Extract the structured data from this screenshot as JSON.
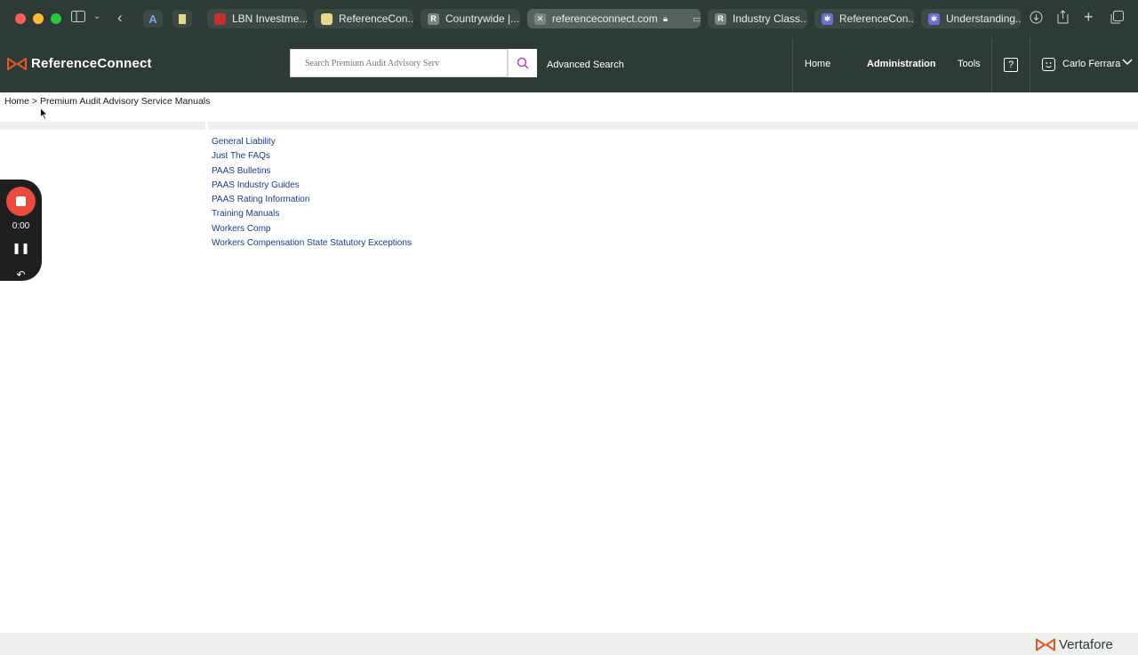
{
  "browser": {
    "tabs": [
      {
        "label": "LBN Investme...",
        "fav_color": "#c4302b",
        "fav_text": ""
      },
      {
        "label": "ReferenceCon...",
        "fav_color": "#e8d88a",
        "fav_text": ""
      },
      {
        "label": "Countrywide |...",
        "fav_color": "#7a8580",
        "fav_text": "R"
      },
      {
        "label": "referenceconnect.com",
        "fav_color": "#7a8580",
        "fav_text": "✕",
        "active": true
      },
      {
        "label": "Industry Class...",
        "fav_color": "#7a8580",
        "fav_text": "R"
      },
      {
        "label": "ReferenceCon...",
        "fav_color": "#6c6fd6",
        "fav_text": "✱"
      },
      {
        "label": "Understanding...",
        "fav_color": "#6c6fd6",
        "fav_text": "✱"
      }
    ],
    "profile_letter": "A"
  },
  "header": {
    "brand": "ReferenceConnect",
    "search_placeholder": "Search Premium Audit Advisory Serv",
    "advanced_search": "Advanced Search",
    "nav": {
      "home": "Home",
      "administration": "Administration",
      "tools": "Tools"
    },
    "help": "?",
    "user_name": "Carlo Ferrara"
  },
  "breadcrumb": "Home > Premium Audit Advisory Service Manuals",
  "links": [
    "General Liability",
    "Just The FAQs",
    "PAAS Bulletins",
    "PAAS Industry Guides",
    "PAAS Rating Information",
    "Training Manuals",
    "Workers Comp",
    "Workers Compensation State Statutory Exceptions"
  ],
  "recorder": {
    "time": "0:00"
  },
  "footer": {
    "brand": "Vertafore"
  },
  "colors": {
    "header_bg": "#2e3a36",
    "link": "#1a3a8a",
    "accent_orange": "#e0572a",
    "record_red": "#ea4b3c"
  }
}
